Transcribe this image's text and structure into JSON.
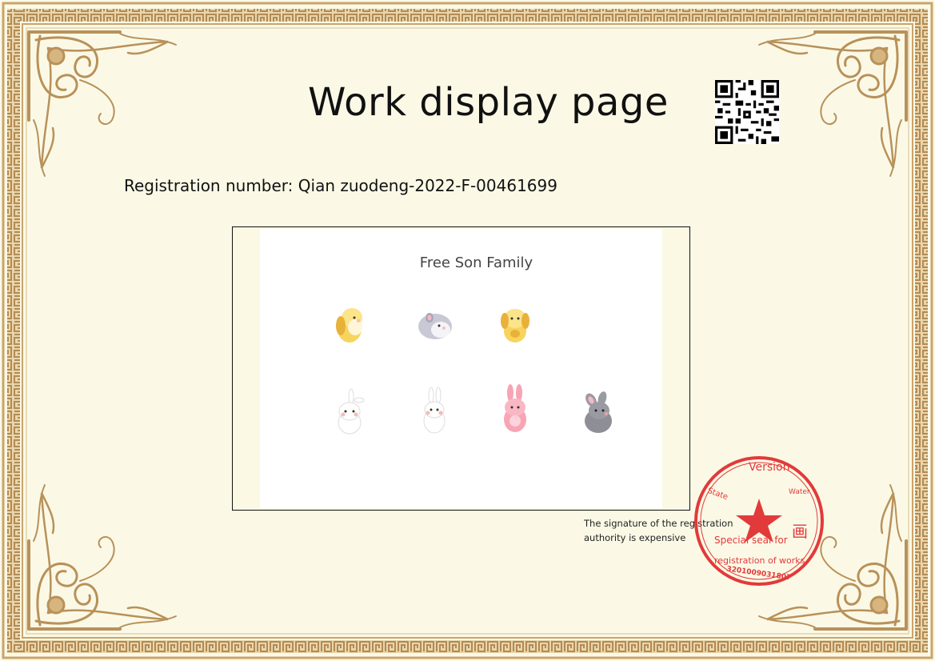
{
  "certificate": {
    "title": "Work display page",
    "registration_number": "Registration number: Qian zuodeng-2022-F-00461699",
    "signature_note": "The signature of the registration authority is expensive",
    "qr_icon": "qr-code-icon"
  },
  "artwork": {
    "title": "Free Son Family",
    "characters": [
      {
        "name": "yellow-puppy-icon",
        "row": 1
      },
      {
        "name": "grey-hamster-icon",
        "row": 1
      },
      {
        "name": "yellow-puppy-sitting-icon",
        "row": 1
      },
      {
        "name": "white-bunny-icon",
        "row": 2
      },
      {
        "name": "white-bunny-standing-icon",
        "row": 2
      },
      {
        "name": "pink-bunny-icon",
        "row": 2
      },
      {
        "name": "grey-bunny-icon",
        "row": 2
      }
    ]
  },
  "seal": {
    "top_text": "Version",
    "left_text": "State",
    "right_text": "Water",
    "char": "画",
    "line1": "Special seal for",
    "line2": "registration of works",
    "bottom_number": "3201009031807",
    "color": "#e23a3a"
  },
  "colors": {
    "background": "#fbf9e6",
    "border_gold": "#b8915a",
    "border_light": "#d9bf8d"
  }
}
